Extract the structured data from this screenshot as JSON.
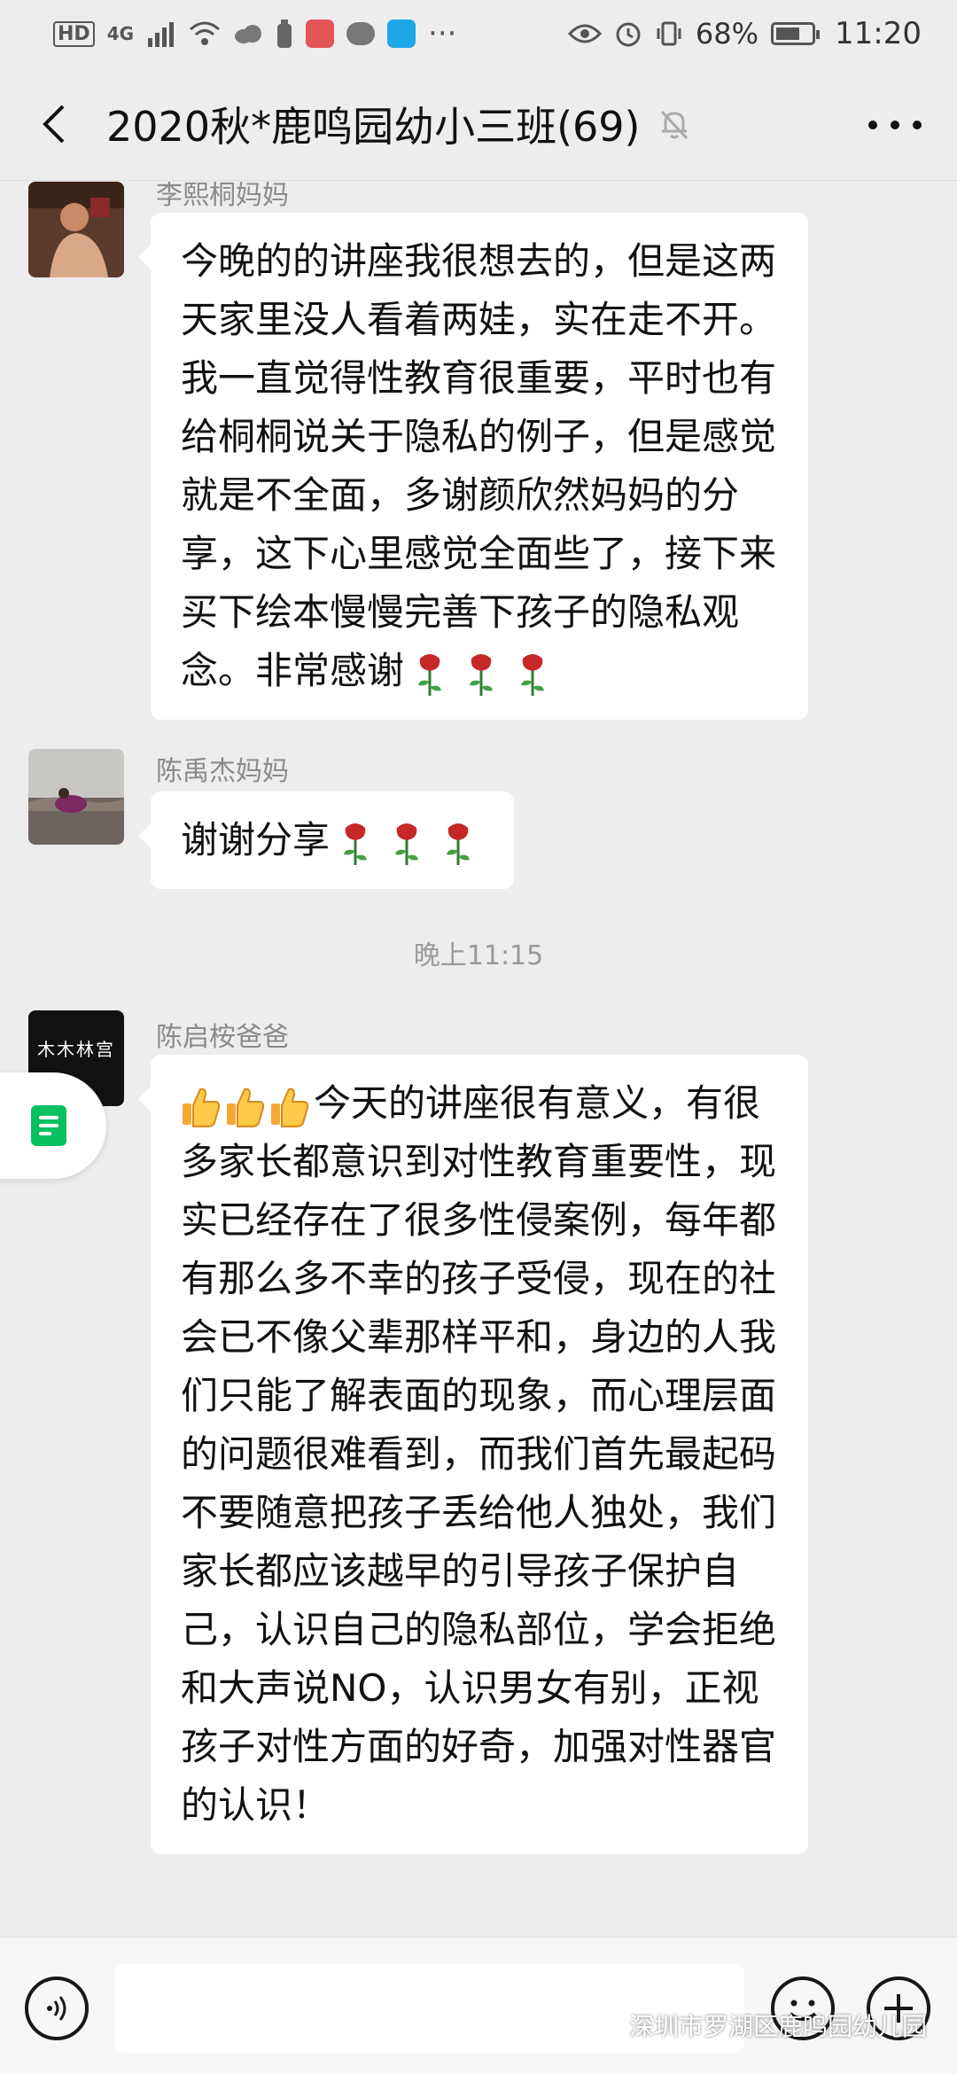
{
  "status_bar": {
    "hd": "HD",
    "network": "4G",
    "battery": "68%",
    "battery_level": 0.68,
    "time": "11:20",
    "more": "···"
  },
  "nav": {
    "title": "2020秋*鹿鸣园幼小三班(69)"
  },
  "messages": [
    {
      "sender": "李熙桐妈妈",
      "text": "今晚的的讲座我很想去的，但是这两天家里没人看着两娃，实在走不开。我一直觉得性教育很重要，平时也有给桐桐说关于隐私的例子，但是感觉就是不全面，多谢颜欣然妈妈的分享，这下心里感觉全面些了，接下来买下绘本慢慢完善下孩子的隐私观念。非常感谢",
      "emoji": "rose"
    },
    {
      "sender": "陈禹杰妈妈",
      "text": "谢谢分享",
      "emoji": "rose"
    },
    {
      "sender": "陈启桉爸爸",
      "text": "今天的讲座很有意义，有很多家长都意识到对性教育重要性，现实已经存在了很多性侵案例，每年都有那么多不幸的孩子受侵，现在的社会已不像父辈那样平和，身边的人我们只能了解表面的现象，而心理层面的问题很难看到，而我们首先最起码不要随意把孩子丢给他人独处，我们家长都应该越早的引导孩子保护自己，认识自己的隐私部位，学会拒绝和大声说NO，认识男女有别，正视孩子对性方面的好奇，加强对性器官的认识！",
      "emoji": "thumbs-up"
    }
  ],
  "time_divider": "晚上11:15",
  "avatar_text": "木木林宫",
  "watermark": "深圳市罗湖区鹿鸣园幼儿园",
  "colors": {
    "background": "#ededed",
    "bubble": "#ffffff",
    "accent": "#07c160"
  }
}
